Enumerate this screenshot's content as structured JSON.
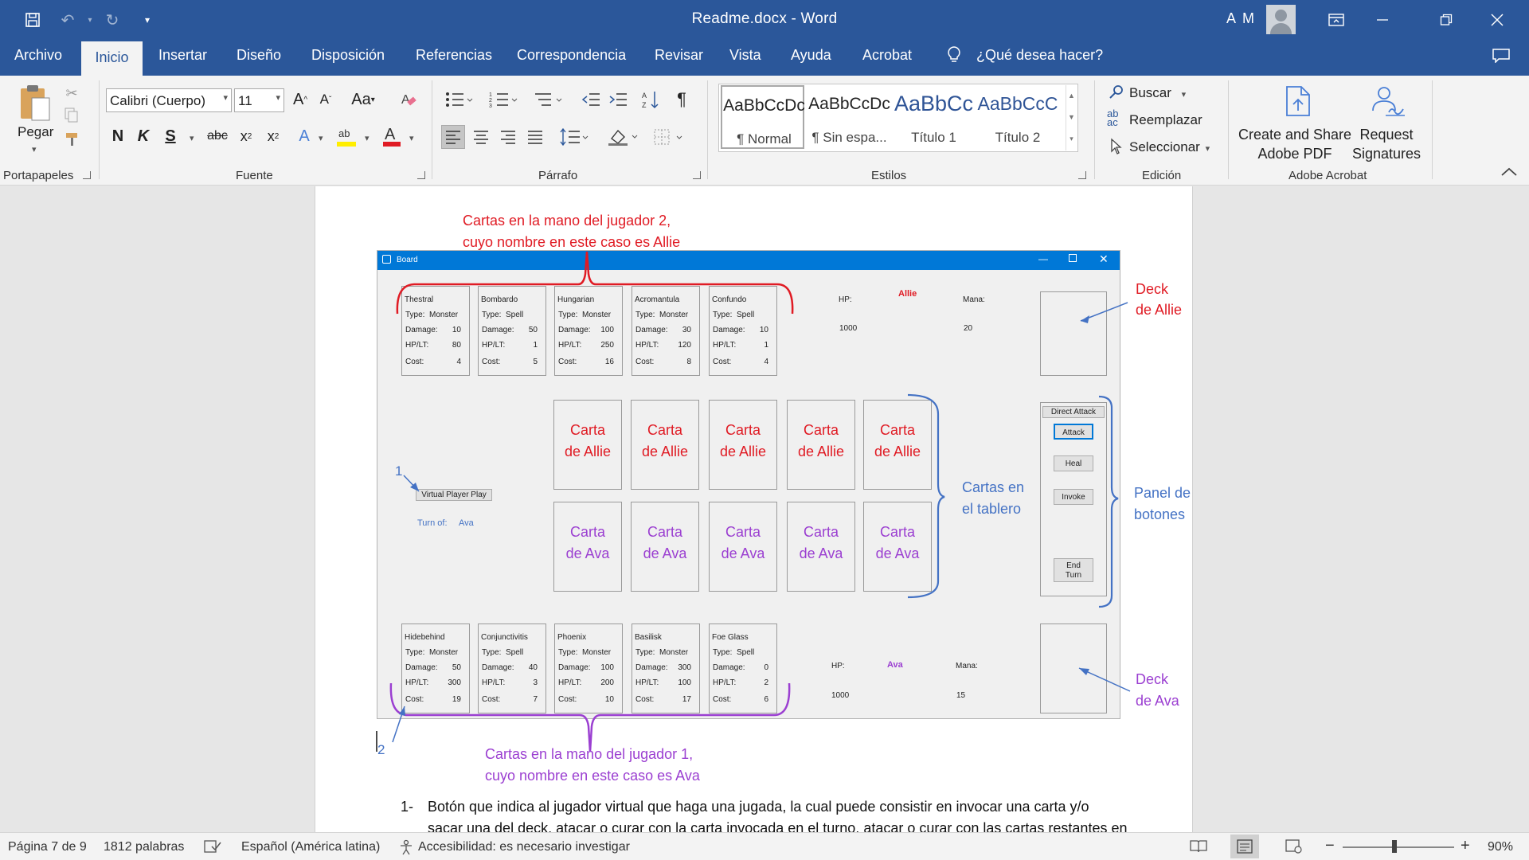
{
  "window": {
    "title": "Readme.docx  -  Word",
    "user_initials": "A M"
  },
  "tabs": [
    "Archivo",
    "Inicio",
    "Insertar",
    "Diseño",
    "Disposición",
    "Referencias",
    "Correspondencia",
    "Revisar",
    "Vista",
    "Ayuda",
    "Acrobat"
  ],
  "active_tab": "Inicio",
  "tell_me": "¿Qué desea hacer?",
  "ribbon": {
    "clipboard": {
      "paste_label": "Pegar",
      "group_label": "Portapapeles"
    },
    "font": {
      "font_name": "Calibri (Cuerpo)",
      "font_size": "11",
      "group_label": "Fuente",
      "bold": "N",
      "italic": "K",
      "underline": "S",
      "strike": "abc",
      "change_case": "Aa"
    },
    "paragraph": {
      "group_label": "Párrafo"
    },
    "styles": {
      "group_label": "Estilos",
      "items": [
        {
          "preview": "AaBbCcDc",
          "name": "¶ Normal"
        },
        {
          "preview": "AaBbCcDc",
          "name": "¶ Sin espa..."
        },
        {
          "preview": "AaBbCc",
          "name": "Título 1"
        },
        {
          "preview": "AaBbCcC",
          "name": "Título 2"
        }
      ]
    },
    "editing": {
      "group_label": "Edición",
      "find": "Buscar",
      "replace": "Reemplazar",
      "select": "Seleccionar"
    },
    "acrobat": {
      "group_label": "Adobe Acrobat",
      "create_share_1": "Create and Share",
      "create_share_2": "Adobe PDF",
      "request_1": "Request",
      "request_2": "Signatures"
    }
  },
  "game": {
    "window_title": "Board",
    "player2": {
      "name": "Allie",
      "hp_label": "HP:",
      "hp": "1000",
      "mana_label": "Mana:",
      "mana": "20"
    },
    "player1": {
      "name": "Ava",
      "hp_label": "HP:",
      "hp": "1000",
      "mana_label": "Mana:",
      "mana": "15"
    },
    "field_labels": {
      "type": "Type:",
      "damage": "Damage:",
      "hplt": "HP/LT:",
      "cost": "Cost:"
    },
    "hand2": [
      {
        "name": "Thestral",
        "type": "Monster",
        "damage": "10",
        "hplt": "80",
        "cost": "4"
      },
      {
        "name": "Bombardo",
        "type": "Spell",
        "damage": "50",
        "hplt": "1",
        "cost": "5"
      },
      {
        "name": "Hungarian",
        "type": "Monster",
        "damage": "100",
        "hplt": "250",
        "cost": "16"
      },
      {
        "name": "Acromantula",
        "type": "Monster",
        "damage": "30",
        "hplt": "120",
        "cost": "8"
      },
      {
        "name": "Confundo",
        "type": "Spell",
        "damage": "10",
        "hplt": "1",
        "cost": "4"
      }
    ],
    "hand1": [
      {
        "name": "Hidebehind",
        "type": "Monster",
        "damage": "50",
        "hplt": "300",
        "cost": "19"
      },
      {
        "name": "Conjunctivitis",
        "type": "Spell",
        "damage": "40",
        "hplt": "3",
        "cost": "7"
      },
      {
        "name": "Phoenix",
        "type": "Monster",
        "damage": "100",
        "hplt": "200",
        "cost": "10"
      },
      {
        "name": "Basilisk",
        "type": "Monster",
        "damage": "300",
        "hplt": "100",
        "cost": "17"
      },
      {
        "name": "Foe Glass",
        "type": "Spell",
        "damage": "0",
        "hplt": "2",
        "cost": "6"
      }
    ],
    "board_allie": [
      "Carta de Allie",
      "Carta de Allie",
      "Carta de Allie",
      "Carta de Allie",
      "Carta de Allie"
    ],
    "board_ava": [
      "Carta de Ava",
      "Carta de Ava",
      "Carta de Ava",
      "Carta de Ava",
      "Carta de Ava"
    ],
    "buttons": {
      "direct_attack": "Direct Attack",
      "attack": "Attack",
      "heal": "Heal",
      "invoke": "Invoke",
      "end_turn": "End Turn",
      "virtual_play": "Virtual Player Play"
    },
    "turn_label": "Turn of:",
    "turn_player": "Ava"
  },
  "annotations": {
    "hand2_line1": "Cartas en la mano del jugador 2,",
    "hand2_line2": "cuyo nombre en este caso es Allie",
    "deck_allie_1": "Deck",
    "deck_allie_2": "de Allie",
    "board_1": "Cartas en",
    "board_2": "el tablero",
    "panel_1": "Panel de",
    "panel_2": "botones",
    "deck_ava_1": "Deck",
    "deck_ava_2": "de Ava",
    "hand1_line1": "Cartas en la mano del jugador 1,",
    "hand1_line2": "cuyo nombre en este caso es Ava",
    "marker1": "1",
    "marker2": "2"
  },
  "body_text": {
    "item_number": "1-",
    "line1": "Botón que indica al jugador virtual que haga una jugada, la cual puede consistir en invocar una carta y/o",
    "line2": "sacar una del deck, atacar o curar con la carta invocada en el turno, atacar o curar con las cartas restantes en"
  },
  "status": {
    "page": "Página 7 de 9",
    "words": "1812 palabras",
    "language": "Español (América latina)",
    "accessibility": "Accesibilidad: es necesario investigar",
    "zoom": "90%"
  },
  "colors": {
    "word_blue": "#2b579a",
    "allie_red": "#e01b24",
    "ava_purple": "#9b3fd1",
    "annotation_blue": "#4472c4"
  }
}
